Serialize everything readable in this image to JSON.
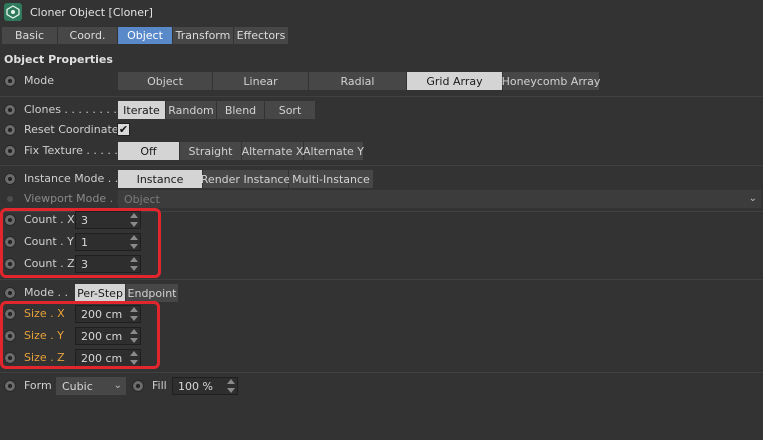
{
  "window": {
    "title": "Cloner Object [Cloner]",
    "icon": "cloner-icon"
  },
  "tabs": [
    {
      "label": "Basic",
      "active": false
    },
    {
      "label": "Coord.",
      "active": false
    },
    {
      "label": "Object",
      "active": true
    },
    {
      "label": "Transform",
      "active": false
    },
    {
      "label": "Effectors",
      "active": false
    }
  ],
  "section_title": "Object Properties",
  "mode": {
    "label": "Mode",
    "options": [
      "Object",
      "Linear",
      "Radial",
      "Grid Array",
      "Honeycomb Array"
    ],
    "selected": "Grid Array"
  },
  "clones": {
    "label": "Clones . . . . . . . .",
    "options": [
      "Iterate",
      "Random",
      "Blend",
      "Sort"
    ],
    "selected": "Iterate"
  },
  "reset_coordinates": {
    "label": "Reset Coordinates",
    "checked": true,
    "check_glyph": "✔"
  },
  "fix_texture": {
    "label": "Fix Texture . . . . . .",
    "options": [
      "Off",
      "Straight",
      "Alternate X",
      "Alternate Y"
    ],
    "selected": "Off"
  },
  "instance_mode": {
    "label": "Instance Mode . .",
    "options": [
      "Instance",
      "Render Instance",
      "Multi-Instance"
    ],
    "selected": "Instance"
  },
  "viewport_mode": {
    "label": "Viewport Mode . .",
    "value": "Object",
    "chevron": "⌄"
  },
  "count": [
    {
      "label": "Count . X",
      "value": "3"
    },
    {
      "label": "Count . Y",
      "value": "1"
    },
    {
      "label": "Count . Z",
      "value": "3"
    }
  ],
  "size_mode": {
    "label": "Mode . .",
    "options": [
      "Per-Step",
      "Endpoint"
    ],
    "selected": "Per-Step"
  },
  "size": [
    {
      "label": "Size . X",
      "value": "200 cm"
    },
    {
      "label": "Size . Y",
      "value": "200 cm"
    },
    {
      "label": "Size . Z",
      "value": "200 cm"
    }
  ],
  "form": {
    "label": "Form",
    "value": "Cubic",
    "chevron": "⌄"
  },
  "fill": {
    "label": "Fill",
    "value": "100 %"
  },
  "colors": {
    "accent": "#5a89c9",
    "highlight": "#e3262d",
    "orange_label": "#e8a23a"
  }
}
